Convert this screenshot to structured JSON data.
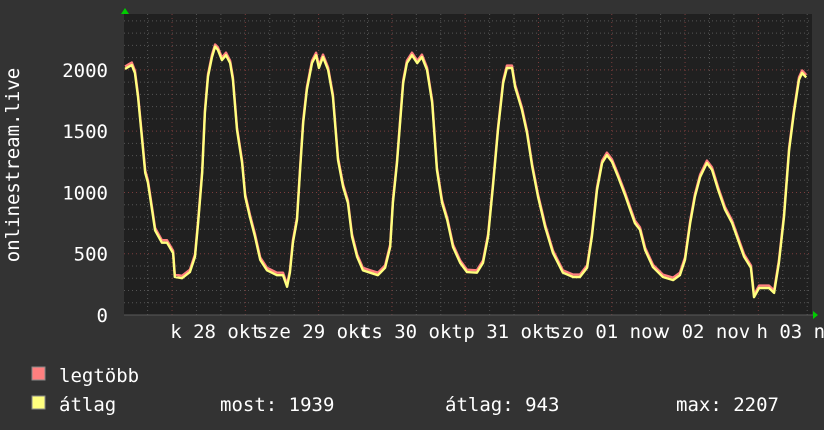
{
  "chart_data": {
    "type": "line",
    "title": "",
    "ylabel": "onlinestream.live",
    "xlabel": "",
    "ylim": [
      0,
      2456
    ],
    "xlim": [
      "10-27 13:30",
      "11-03 13:30"
    ],
    "yticks": [
      "0",
      "500",
      "1000",
      "1500",
      "2000"
    ],
    "xtick_labels": [
      "k 28 okt",
      "sze 29 okt",
      "cs 30 okt",
      "p 31 okt",
      "szo 01 nov",
      "v 02 nov",
      "h 03 nov"
    ],
    "grid": true,
    "legend_position": "bottom-left",
    "x": [
      "10-27 13:45",
      "10-27 15:25",
      "10-27 16:10",
      "10-27 16:55",
      "10-27 17:55",
      "10-27 18:40",
      "10-27 19:20",
      "10-27 20:20",
      "10-27 21:05",
      "10-27 22:45",
      "10-28 00:00",
      "10-28 01:30",
      "10-28 01:55",
      "10-28 03:40",
      "10-28 05:35",
      "10-28 06:50",
      "10-28 07:35",
      "10-28 08:35",
      "10-28 09:15",
      "10-28 10:00",
      "10-28 11:00",
      "10-28 11:45",
      "10-28 12:25",
      "10-28 13:25",
      "10-28 14:25",
      "10-28 15:25",
      "10-28 16:05",
      "10-28 17:05",
      "10-28 18:20",
      "10-28 19:05",
      "10-28 20:15",
      "10-28 21:30",
      "10-28 22:45",
      "10-29 00:25",
      "10-29 02:50",
      "10-29 04:20",
      "10-29 05:20",
      "10-29 06:00",
      "10-29 06:45",
      "10-29 07:45",
      "10-29 08:30",
      "10-29 09:15",
      "10-29 10:10",
      "10-29 11:25",
      "10-29 12:25",
      "10-29 13:05",
      "10-29 14:05",
      "10-29 15:20",
      "10-29 16:30",
      "10-29 17:45",
      "10-29 19:00",
      "10-29 20:10",
      "10-29 21:10",
      "10-29 22:25",
      "10-29 23:50",
      "10-30 01:35",
      "10-30 03:30",
      "10-30 05:15",
      "10-30 06:30",
      "10-30 07:10",
      "10-30 08:10",
      "10-30 08:55",
      "10-30 09:40",
      "10-30 10:35",
      "10-30 11:50",
      "10-30 13:05",
      "10-30 14:15",
      "10-30 15:30",
      "10-30 16:45",
      "10-30 17:55",
      "10-30 19:10",
      "10-30 20:25",
      "10-30 21:50",
      "10-30 23:35",
      "10-31 01:15",
      "10-31 03:40",
      "10-31 05:10",
      "10-31 06:25",
      "10-31 07:35",
      "10-31 08:50",
      "10-31 10:05",
      "10-31 11:00",
      "10-31 12:15",
      "10-31 13:00",
      "10-31 14:40",
      "10-31 15:55",
      "10-31 17:10",
      "10-31 18:35",
      "10-31 20:20",
      "10-31 22:15",
      "11-01 00:40",
      "11-01 03:10",
      "11-01 04:50",
      "11-01 06:35",
      "11-01 07:45",
      "11-01 09:00",
      "11-01 10:15",
      "11-01 11:25",
      "11-01 12:40",
      "11-01 14:10",
      "11-01 15:50",
      "11-01 17:05",
      "11-01 18:15",
      "11-01 19:30",
      "11-01 20:45",
      "11-01 22:40",
      "11-02 01:05",
      "11-02 03:35",
      "11-02 05:15",
      "11-02 06:30",
      "11-02 07:45",
      "11-02 08:55",
      "11-02 10:10",
      "11-02 11:50",
      "11-02 13:05",
      "11-02 14:35",
      "11-02 16:15",
      "11-02 18:00",
      "11-02 19:10",
      "11-02 20:55",
      "11-02 22:35",
      "11-02 23:20",
      "11-03 00:35",
      "11-03 03:00",
      "11-03 04:15",
      "11-03 05:25",
      "11-03 06:40",
      "11-03 07:55",
      "11-03 09:05",
      "11-03 10:20",
      "11-03 11:05",
      "11-03 12:05"
    ],
    "series": [
      {
        "name": "legtöbb",
        "color": "#ff7f7f",
        "values": [
          2028,
          2060,
          1995,
          1800,
          1450,
          1180,
          1100,
          880,
          710,
          610,
          610,
          525,
          330,
          320,
          370,
          495,
          770,
          1180,
          1670,
          1965,
          2125,
          2207,
          2185,
          2100,
          2140,
          2075,
          1940,
          1530,
          1260,
          985,
          820,
          660,
          470,
          385,
          345,
          345,
          250,
          365,
          610,
          795,
          1205,
          1590,
          1860,
          2075,
          2140,
          2035,
          2125,
          2020,
          1800,
          1285,
          1065,
          935,
          660,
          495,
          385,
          365,
          345,
          405,
          575,
          935,
          1260,
          1590,
          1915,
          2075,
          2140,
          2075,
          2125,
          2020,
          1750,
          1205,
          935,
          795,
          575,
          445,
          370,
          365,
          445,
          660,
          1065,
          1530,
          1915,
          2035,
          2035,
          1880,
          1695,
          1505,
          1230,
          985,
          740,
          525,
          365,
          330,
          330,
          405,
          660,
          1040,
          1260,
          1325,
          1270,
          1145,
          1000,
          880,
          770,
          715,
          550,
          410,
          330,
          305,
          345,
          470,
          770,
          985,
          1145,
          1260,
          1205,
          1040,
          880,
          770,
          660,
          495,
          405,
          165,
          240,
          240,
          200,
          445,
          820,
          1365,
          1670,
          1940,
          1995,
          1959
        ]
      },
      {
        "name": "átlag",
        "color": "#ffff7f",
        "values": [
          2008,
          2040,
          1975,
          1780,
          1430,
          1160,
          1080,
          860,
          690,
          590,
          590,
          505,
          310,
          300,
          350,
          475,
          750,
          1160,
          1650,
          1945,
          2105,
          2190,
          2165,
          2080,
          2120,
          2055,
          1920,
          1510,
          1240,
          965,
          800,
          640,
          450,
          365,
          325,
          325,
          230,
          345,
          590,
          775,
          1185,
          1570,
          1840,
          2055,
          2120,
          2015,
          2105,
          2000,
          1780,
          1265,
          1045,
          915,
          640,
          475,
          365,
          345,
          325,
          385,
          555,
          915,
          1240,
          1570,
          1895,
          2055,
          2120,
          2055,
          2105,
          2000,
          1730,
          1185,
          915,
          775,
          555,
          425,
          350,
          345,
          425,
          640,
          1045,
          1510,
          1895,
          2015,
          2015,
          1860,
          1675,
          1485,
          1210,
          965,
          720,
          505,
          345,
          310,
          310,
          385,
          640,
          1020,
          1240,
          1305,
          1250,
          1125,
          980,
          860,
          750,
          695,
          530,
          390,
          310,
          285,
          325,
          450,
          750,
          965,
          1125,
          1240,
          1185,
          1020,
          860,
          750,
          640,
          475,
          385,
          145,
          220,
          220,
          180,
          425,
          800,
          1345,
          1650,
          1920,
          1975,
          1939
        ]
      }
    ]
  },
  "legend": {
    "max_label": "legtöbb",
    "avg_label": "átlag",
    "max_color": "#ff7f7f",
    "avg_color": "#ffff7f",
    "now_text": "most: 1939",
    "avg_text": "átlag: 943",
    "max_text": "max: 2207"
  }
}
